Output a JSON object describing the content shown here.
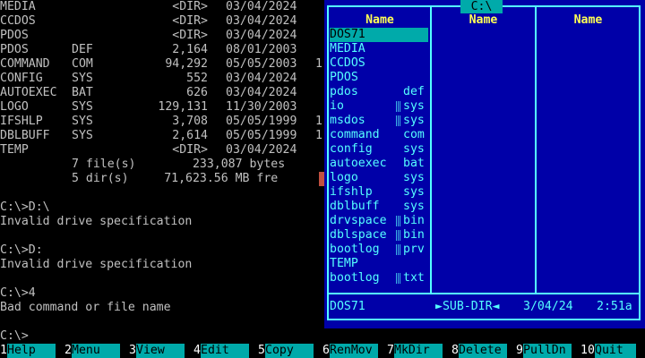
{
  "console": {
    "listing": [
      {
        "name": "MEDIA",
        "ext": "",
        "size": "<DIR>",
        "date": "03/04/2024",
        "time": ""
      },
      {
        "name": "CCDOS",
        "ext": "",
        "size": "<DIR>",
        "date": "03/04/2024",
        "time": ""
      },
      {
        "name": "PDOS",
        "ext": "",
        "size": "<DIR>",
        "date": "03/04/2024",
        "time": ""
      },
      {
        "name": "PDOS",
        "ext": "DEF",
        "size": "2,164",
        "date": "08/01/2003",
        "time": ""
      },
      {
        "name": "COMMAND",
        "ext": "COM",
        "size": "94,292",
        "date": "05/05/2003",
        "time": "1"
      },
      {
        "name": "CONFIG",
        "ext": "SYS",
        "size": "552",
        "date": "03/04/2024",
        "time": ""
      },
      {
        "name": "AUTOEXEC",
        "ext": "BAT",
        "size": "626",
        "date": "03/04/2024",
        "time": ""
      },
      {
        "name": "LOGO",
        "ext": "SYS",
        "size": "129,131",
        "date": "11/30/2003",
        "time": ""
      },
      {
        "name": "IFSHLP",
        "ext": "SYS",
        "size": "3,708",
        "date": "05/05/1999",
        "time": "1"
      },
      {
        "name": "DBLBUFF",
        "ext": "SYS",
        "size": "2,614",
        "date": "05/05/1999",
        "time": "1"
      },
      {
        "name": "TEMP",
        "ext": "",
        "size": "<DIR>",
        "date": "03/04/2024",
        "time": ""
      }
    ],
    "summary_files": "7 file(s)        233,087 bytes",
    "summary_dirs": "5 dir(s)     71,623.56 MB fre",
    "session": [
      "C:\\>D:\\",
      "Invalid drive specification",
      "",
      "C:\\>D:",
      "Invalid drive specification",
      "",
      "C:\\>4",
      "Bad command or file name",
      "",
      "C:\\>"
    ]
  },
  "panel": {
    "title": "C:\\",
    "column_headers": [
      "Name",
      "Name",
      "Name"
    ],
    "files": [
      {
        "name": "DOS71",
        "ext": "",
        "dir": true,
        "selected": true,
        "shaded": false
      },
      {
        "name": "MEDIA",
        "ext": "",
        "dir": true,
        "selected": false,
        "shaded": false
      },
      {
        "name": "CCDOS",
        "ext": "",
        "dir": true,
        "selected": false,
        "shaded": false
      },
      {
        "name": "PDOS",
        "ext": "",
        "dir": true,
        "selected": false,
        "shaded": false
      },
      {
        "name": "pdos",
        "ext": "def",
        "dir": false,
        "selected": false,
        "shaded": false
      },
      {
        "name": "io",
        "ext": "sys",
        "dir": false,
        "selected": false,
        "shaded": true
      },
      {
        "name": "msdos",
        "ext": "sys",
        "dir": false,
        "selected": false,
        "shaded": true
      },
      {
        "name": "command",
        "ext": "com",
        "dir": false,
        "selected": false,
        "shaded": false
      },
      {
        "name": "config",
        "ext": "sys",
        "dir": false,
        "selected": false,
        "shaded": false
      },
      {
        "name": "autoexec",
        "ext": "bat",
        "dir": false,
        "selected": false,
        "shaded": false
      },
      {
        "name": "logo",
        "ext": "sys",
        "dir": false,
        "selected": false,
        "shaded": false
      },
      {
        "name": "ifshlp",
        "ext": "sys",
        "dir": false,
        "selected": false,
        "shaded": false
      },
      {
        "name": "dblbuff",
        "ext": "sys",
        "dir": false,
        "selected": false,
        "shaded": false
      },
      {
        "name": "drvspace",
        "ext": "bin",
        "dir": false,
        "selected": false,
        "shaded": true
      },
      {
        "name": "dblspace",
        "ext": "bin",
        "dir": false,
        "selected": false,
        "shaded": true
      },
      {
        "name": "bootlog",
        "ext": "prv",
        "dir": false,
        "selected": false,
        "shaded": true
      },
      {
        "name": "TEMP",
        "ext": "",
        "dir": true,
        "selected": false,
        "shaded": false
      },
      {
        "name": "bootlog",
        "ext": "txt",
        "dir": false,
        "selected": false,
        "shaded": true
      }
    ],
    "status": {
      "name": "DOS71",
      "type": "►SUB-DIR◄",
      "date": "3/04/24",
      "time": "2:51a"
    }
  },
  "fkeys": [
    {
      "num": "1",
      "label": "Help"
    },
    {
      "num": "2",
      "label": "Menu"
    },
    {
      "num": "3",
      "label": "View"
    },
    {
      "num": "4",
      "label": "Edit"
    },
    {
      "num": "5",
      "label": "Copy"
    },
    {
      "num": "6",
      "label": "RenMov"
    },
    {
      "num": "7",
      "label": "MkDir"
    },
    {
      "num": "8",
      "label": "Delete"
    },
    {
      "num": "9",
      "label": "PullDn"
    },
    {
      "num": "10",
      "label": "Quit"
    }
  ],
  "colors": {
    "panel_bg": "#0000a8",
    "panel_fg": "#55ffff",
    "header_fg": "#ffff55",
    "highlight": "#00aaaa",
    "console_fg": "#c0c0c0"
  }
}
